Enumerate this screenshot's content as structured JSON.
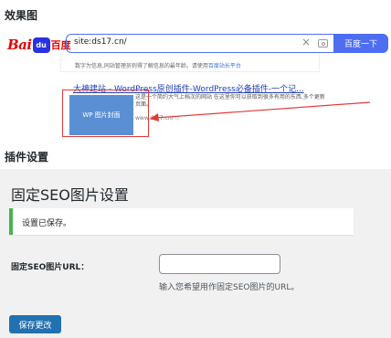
{
  "effect": {
    "heading": "效果图"
  },
  "baidu": {
    "logo_bai": "Bai",
    "logo_du": "du",
    "logo_cn": "百度",
    "query": "site:ds17.cn/",
    "clear_icon": "close-icon",
    "camera_icon": "camera-icon",
    "search_button": "百度一下",
    "prev_snippet": "数字为信息,同站管理员则得了解信息的最年龄。请使用",
    "prev_snippet_link": "百度站长平台",
    "result_title": "大神建站 - WordPress原创插件-WordPress必备插件-一个记...",
    "result_desc": "这是一个简约大气上档次的网站 在这里你可以获取到很多有用的东西,多个更新页面。",
    "result_url": "www.ds17.cn/",
    "thumb_text": "WP 图片封面"
  },
  "plugin": {
    "heading": "插件设置",
    "page_title": "固定SEO图片设置",
    "notice": "设置已保存。",
    "field_label": "固定SEO图片URL：",
    "field_value": "",
    "field_description": "输入您希望用作固定SEO图片的URL。",
    "save_button": "保存更改"
  },
  "colors": {
    "baidu_blue": "#4e6ef2",
    "baidu_red": "#e10601",
    "wp_primary": "#2271b1",
    "notice_success": "#46b450",
    "annotation_red": "#e23a3a"
  }
}
